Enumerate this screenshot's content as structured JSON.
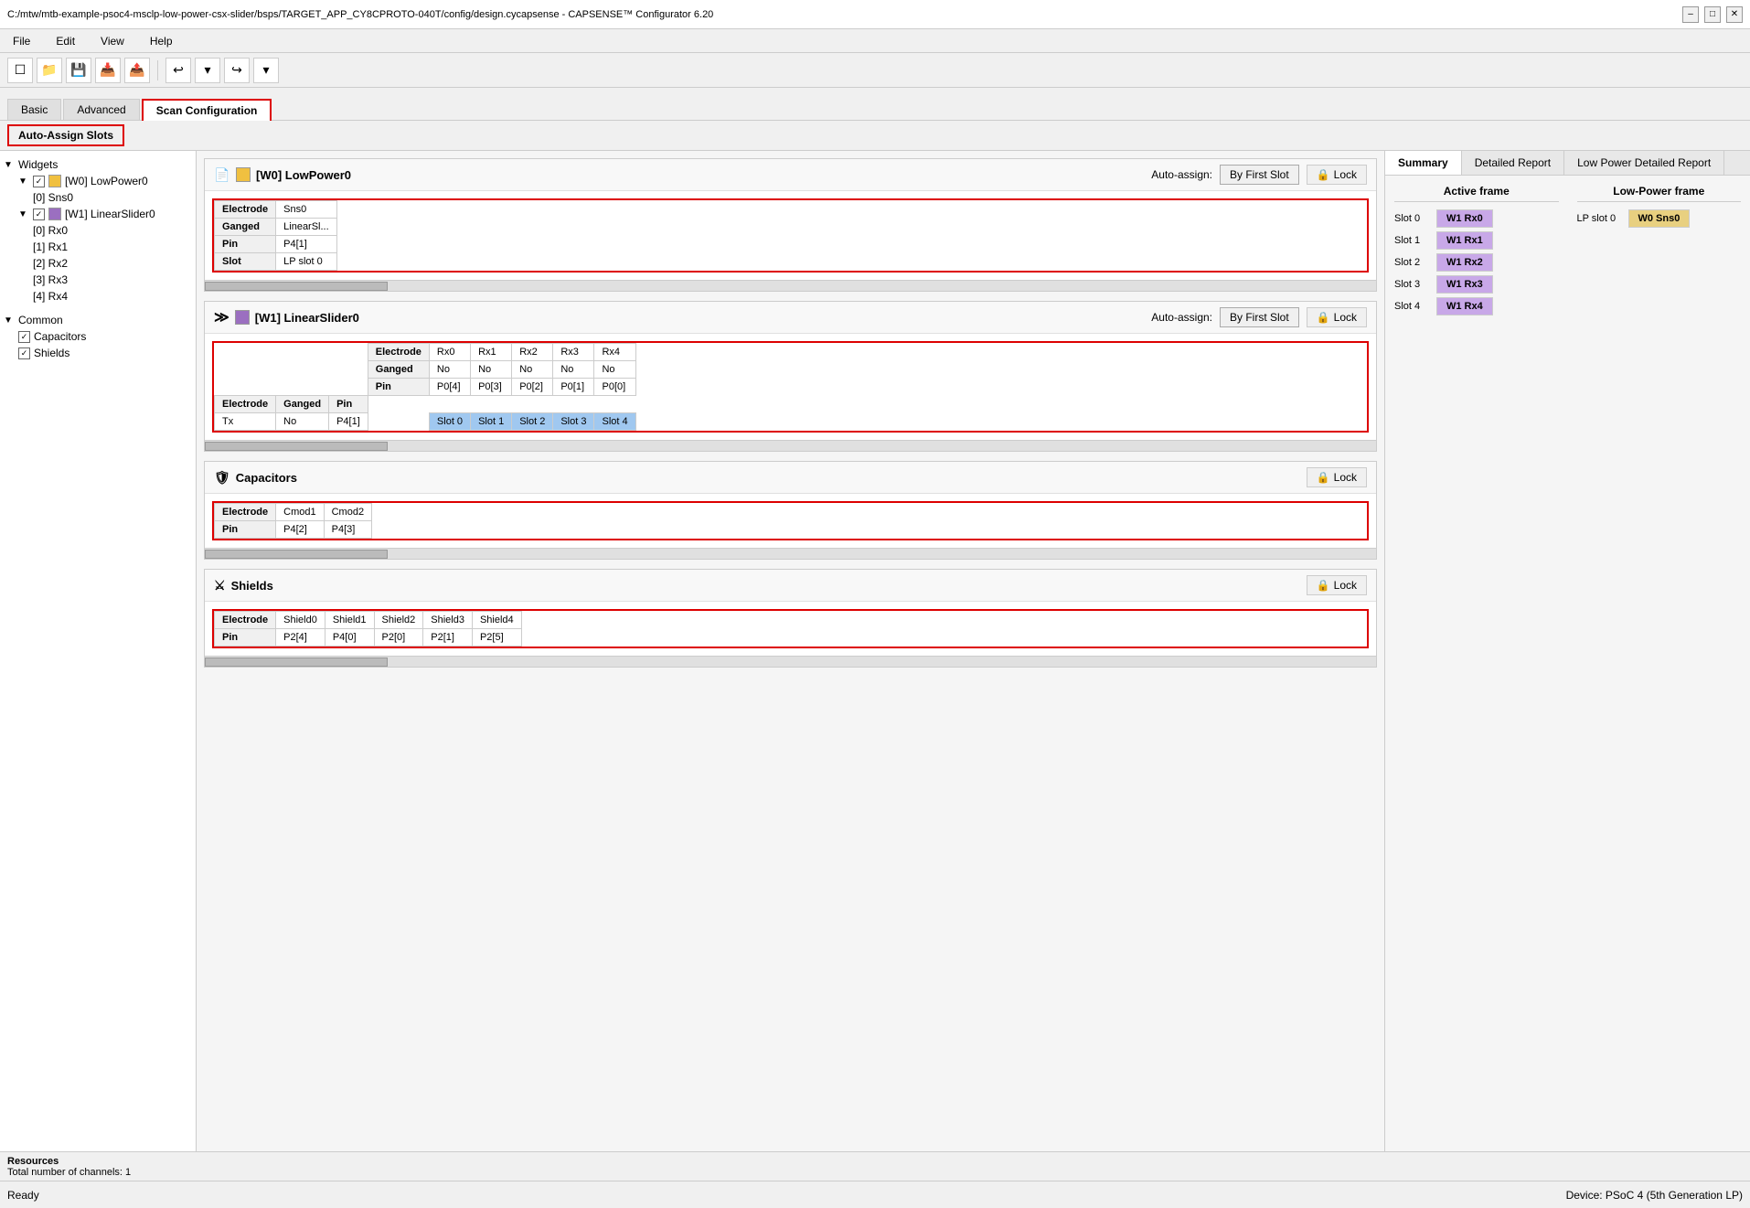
{
  "titleBar": {
    "title": "C:/mtw/mtb-example-psoc4-msclp-low-power-csx-slider/bsps/TARGET_APP_CY8CPROTO-040T/config/design.cycapsense - CAPSENSE™ Configurator 6.20",
    "minimize": "–",
    "maximize": "□",
    "close": "✕"
  },
  "menu": {
    "items": [
      "File",
      "Edit",
      "View",
      "Help"
    ]
  },
  "tabs": {
    "items": [
      "Basic",
      "Advanced",
      "Scan Configuration"
    ],
    "active": 2
  },
  "autoAssign": {
    "label": "Auto-Assign Slots"
  },
  "tree": {
    "widgetsLabel": "Widgets",
    "w0Label": "[W0] LowPower0",
    "w0_sns0": "[0] Sns0",
    "w1Label": "[W1] LinearSlider0",
    "w1_rx0": "[0] Rx0",
    "w1_rx1": "[1] Rx1",
    "w1_rx2": "[2] Rx2",
    "w1_rx3": "[3] Rx3",
    "w1_rx4": "[4] Rx4",
    "commonLabel": "Common",
    "capacitors": "Capacitors",
    "shields": "Shields"
  },
  "w0": {
    "title": "[W0] LowPower0",
    "autoAssignLabel": "Auto-assign:",
    "byFirstSlot": "By First Slot",
    "lock": "Lock",
    "table": {
      "rows": [
        {
          "label": "Electrode",
          "col1": "Sns0"
        },
        {
          "label": "Ganged",
          "col1": "LinearSl..."
        },
        {
          "label": "Pin",
          "col1": "P4[1]"
        },
        {
          "label": "Slot",
          "col1": "LP slot 0"
        }
      ]
    }
  },
  "w1": {
    "title": "[W1] LinearSlider0",
    "autoAssignLabel": "Auto-assign:",
    "byFirstSlot": "By First Slot",
    "lock": "Lock",
    "topTable": {
      "electrodeLabel": "Electrode",
      "gangedLabel": "Ganged",
      "pinLabel": "Pin",
      "cols": [
        {
          "electrode": "Rx0",
          "ganged": "No",
          "pin": "P0[4]"
        },
        {
          "electrode": "Rx1",
          "ganged": "No",
          "pin": "P0[3]"
        },
        {
          "electrode": "Rx2",
          "ganged": "No",
          "pin": "P0[2]"
        },
        {
          "electrode": "Rx3",
          "ganged": "No",
          "pin": "P0[1]"
        },
        {
          "electrode": "Rx4",
          "ganged": "No",
          "pin": "P0[0]"
        }
      ]
    },
    "bottomTable": {
      "cols": [
        "Electrode",
        "Ganged",
        "Pin"
      ],
      "row": {
        "electrode": "Tx",
        "ganged": "No",
        "pin": "P4[1]",
        "slots": [
          "Slot 0",
          "Slot 1",
          "Slot 2",
          "Slot 3",
          "Slot 4"
        ]
      }
    }
  },
  "capacitors": {
    "title": "Capacitors",
    "lock": "Lock",
    "table": {
      "rows": [
        {
          "label": "Electrode",
          "col1": "Cmod1",
          "col2": "Cmod2"
        },
        {
          "label": "Pin",
          "col1": "P4[2]",
          "col2": "P4[3]"
        }
      ]
    }
  },
  "shields": {
    "title": "Shields",
    "lock": "Lock",
    "table": {
      "rows": [
        {
          "label": "Electrode",
          "col1": "Shield0",
          "col2": "Shield1",
          "col3": "Shield2",
          "col4": "Shield3",
          "col5": "Shield4"
        },
        {
          "label": "Pin",
          "col1": "P2[4]",
          "col2": "P4[0]",
          "col3": "P2[0]",
          "col4": "P2[1]",
          "col5": "P2[5]"
        }
      ]
    }
  },
  "summary": {
    "tabs": [
      "Summary",
      "Detailed Report",
      "Low Power Detailed Report"
    ],
    "activeTab": 0,
    "activeFrameTitle": "Active frame",
    "lowPowerFrameTitle": "Low-Power frame",
    "activeSlots": [
      {
        "slot": "Slot 0",
        "badge": "W1 Rx0"
      },
      {
        "slot": "Slot 1",
        "badge": "W1 Rx1"
      },
      {
        "slot": "Slot 2",
        "badge": "W1 Rx2"
      },
      {
        "slot": "Slot 3",
        "badge": "W1 Rx3"
      },
      {
        "slot": "Slot 4",
        "badge": "W1 Rx4"
      }
    ],
    "lpSlots": [
      {
        "slot": "LP slot 0",
        "badge": "W0 Sns0"
      }
    ]
  },
  "resources": {
    "label": "Resources",
    "totalChannels": "Total number of channels: 1"
  },
  "statusBar": {
    "left": "Ready",
    "right": "Device: PSoC 4 (5th Generation LP)"
  }
}
